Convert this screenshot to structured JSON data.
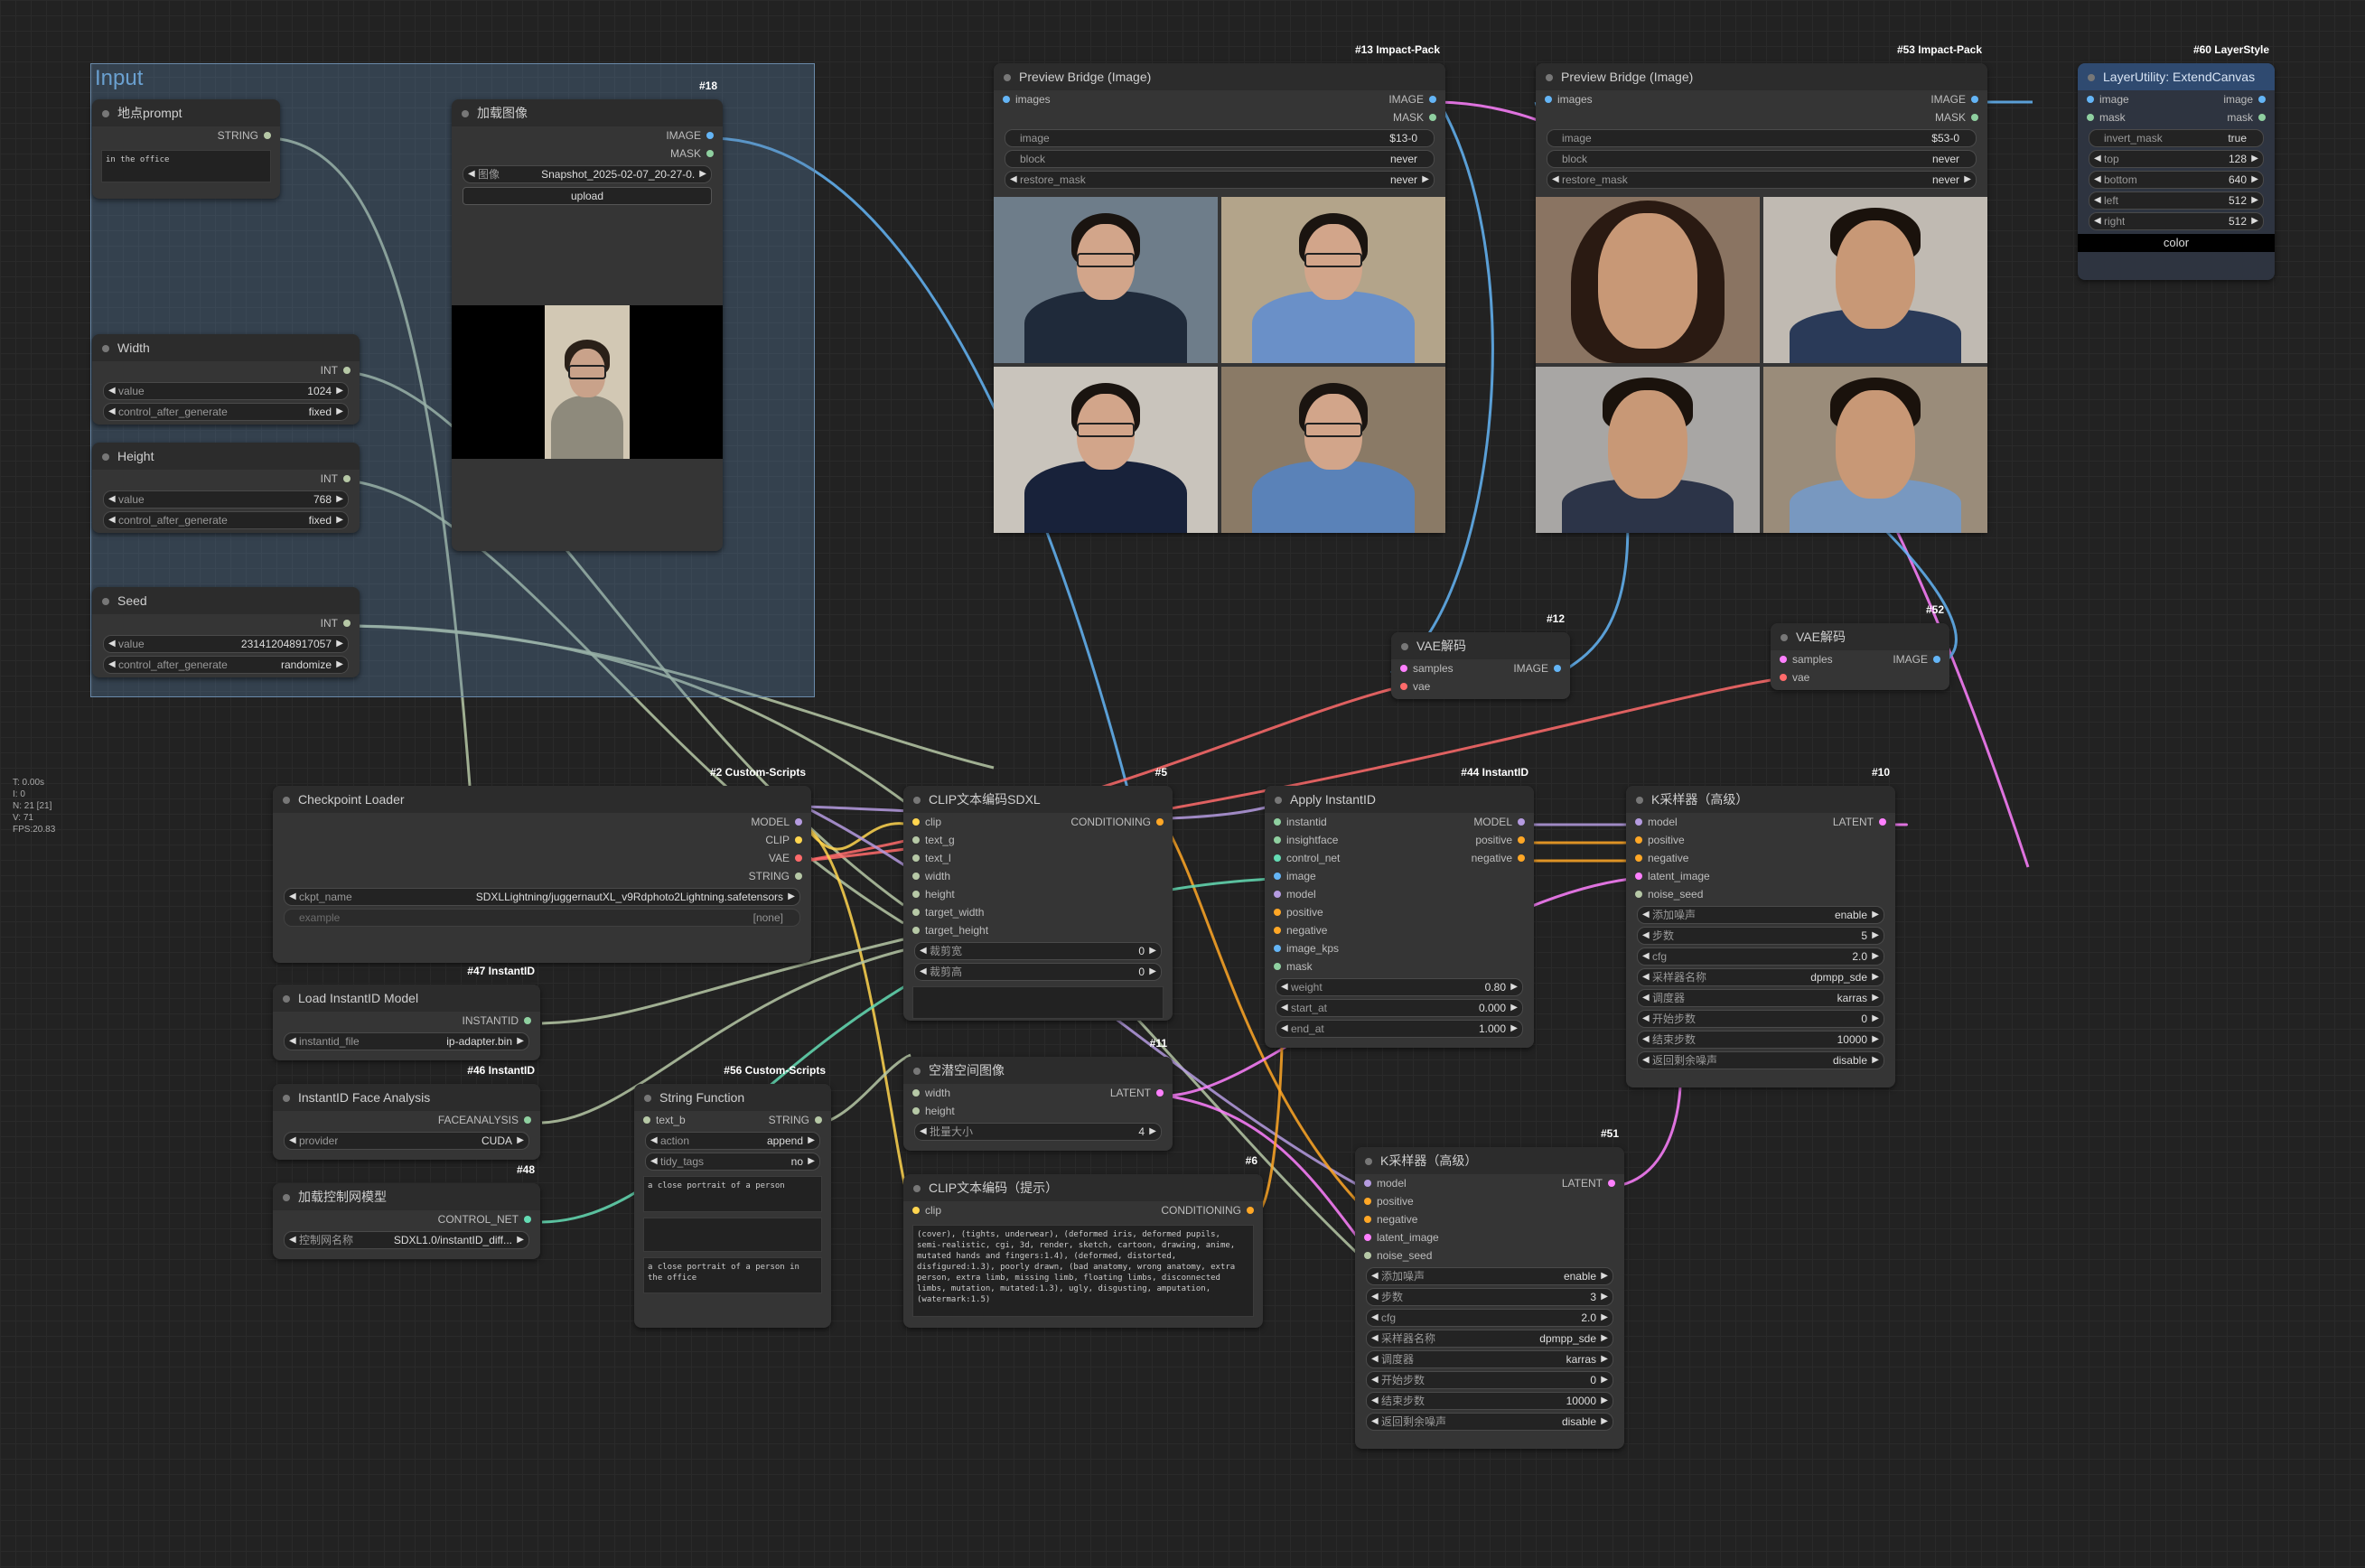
{
  "group": {
    "title": "Input"
  },
  "stats": [
    "T: 0.00s",
    "I: 0",
    "N: 21 [21]",
    "V: 71",
    "FPS:20.83"
  ],
  "nodes": {
    "prompt": {
      "title": "地点prompt",
      "out": "STRING",
      "text": "in the office"
    },
    "load_image": {
      "title": "加载图像",
      "id": "#18",
      "outs": [
        "IMAGE",
        "MASK"
      ],
      "image_label": "图像",
      "image_value": "Snapshot_2025-02-07_20-27-0...",
      "upload": "upload"
    },
    "width": {
      "title": "Width",
      "out": "INT",
      "w1l": "value",
      "w1v": "1024",
      "w2l": "control_after_generate",
      "w2v": "fixed"
    },
    "height": {
      "title": "Height",
      "out": "INT",
      "w1l": "value",
      "w1v": "768",
      "w2l": "control_after_generate",
      "w2v": "fixed"
    },
    "seed": {
      "title": "Seed",
      "out": "INT",
      "w1l": "value",
      "w1v": "231412048917057",
      "w2l": "control_after_generate",
      "w2v": "randomize"
    },
    "preview1": {
      "title": "Preview Bridge (Image)",
      "id": "#13 Impact-Pack",
      "in": "images",
      "outs": [
        "IMAGE",
        "MASK"
      ],
      "w1l": "image",
      "w1v": "$13-0",
      "w2l": "block",
      "w2v": "never",
      "w3l": "restore_mask",
      "w3v": "never"
    },
    "preview2": {
      "title": "Preview Bridge (Image)",
      "id": "#53 Impact-Pack",
      "in": "images",
      "outs": [
        "IMAGE",
        "MASK"
      ],
      "w1l": "image",
      "w1v": "$53-0",
      "w2l": "block",
      "w2v": "never",
      "w3l": "restore_mask",
      "w3v": "never"
    },
    "extend": {
      "title": "LayerUtility: ExtendCanvas",
      "id": "#60 LayerStyle",
      "ins": [
        "image",
        "mask"
      ],
      "outs": [
        "image",
        "mask"
      ],
      "w": [
        [
          "invert_mask",
          "true"
        ],
        [
          "top",
          "128"
        ],
        [
          "bottom",
          "640"
        ],
        [
          "left",
          "512"
        ],
        [
          "right",
          "512"
        ]
      ],
      "color_btn": "color"
    },
    "vae12": {
      "title": "VAE解码",
      "id": "#12",
      "ins": [
        "samples",
        "vae"
      ],
      "out": "IMAGE"
    },
    "vae52": {
      "title": "VAE解码",
      "id": "#52",
      "ins": [
        "samples",
        "vae"
      ],
      "out": "IMAGE"
    },
    "ckpt": {
      "title": "Checkpoint Loader",
      "id": "#2 Custom-Scripts",
      "outs": [
        "MODEL",
        "CLIP",
        "VAE",
        "STRING"
      ],
      "w1l": "ckpt_name",
      "w1v": "SDXLLightning/juggernautXL_v9Rdphoto2Lightning.safetensors",
      "w2l": "example",
      "w2v": "[none]"
    },
    "clip5": {
      "title": "CLIP文本编码SDXL",
      "id": "#5",
      "ins": [
        "clip",
        "text_g",
        "text_l",
        "width",
        "height",
        "target_width",
        "target_height"
      ],
      "out": "CONDITIONING",
      "w1l": "裁剪宽",
      "w1v": "0",
      "w2l": "裁剪高",
      "w2v": "0"
    },
    "apply": {
      "title": "Apply InstantID",
      "id": "#44 InstantID",
      "ins": [
        "instantid",
        "insightface",
        "control_net",
        "image",
        "model",
        "positive",
        "negative",
        "image_kps",
        "mask"
      ],
      "outs": [
        "MODEL",
        "positive",
        "negative"
      ],
      "w": [
        [
          "weight",
          "0.80"
        ],
        [
          "start_at",
          "0.000"
        ],
        [
          "end_at",
          "1.000"
        ]
      ]
    },
    "ks10": {
      "title": "K采样器（高级）",
      "id": "#10",
      "ins": [
        "model",
        "positive",
        "negative",
        "latent_image",
        "noise_seed"
      ],
      "out": "LATENT",
      "w": [
        [
          "添加噪声",
          "enable"
        ],
        [
          "步数",
          "5"
        ],
        [
          "cfg",
          "2.0"
        ],
        [
          "采样器名称",
          "dpmpp_sde"
        ],
        [
          "调度器",
          "karras"
        ],
        [
          "开始步数",
          "0"
        ],
        [
          "结束步数",
          "10000"
        ],
        [
          "返回剩余噪声",
          "disable"
        ]
      ]
    },
    "load_iid": {
      "title": "Load InstantID Model",
      "id": "#47 InstantID",
      "out": "INSTANTID",
      "w1l": "instantid_file",
      "w1v": "ip-adapter.bin"
    },
    "face": {
      "title": "InstantID Face Analysis",
      "id": "#46 InstantID",
      "out": "FACEANALYSIS",
      "w1l": "provider",
      "w1v": "CUDA"
    },
    "cnet": {
      "title": "加载控制网模型",
      "id": "#48",
      "out": "CONTROL_NET",
      "w1l": "控制网名称",
      "w1v": "SDXL1.0/instantID_diff..."
    },
    "strfn": {
      "title": "String Function",
      "id": "#56 Custom-Scripts",
      "in": "text_b",
      "out": "STRING",
      "w1l": "action",
      "w1v": "append",
      "w2l": "tidy_tags",
      "w2v": "no",
      "t1": "a close portrait of a person",
      "t2": "",
      "t3": "a close portrait of a person in the office"
    },
    "latent": {
      "title": "空潜空间图像",
      "id": "#11",
      "ins": [
        "width",
        "height"
      ],
      "out": "LATENT",
      "w1l": "批量大小",
      "w1v": "4"
    },
    "clip6": {
      "title": "CLIP文本编码（提示）",
      "id": "#6",
      "in": "clip",
      "out": "CONDITIONING",
      "text": "(cover), (tights, underwear), (deformed iris, deformed pupils, semi-realistic, cgi, 3d, render, sketch, cartoon, drawing, anime, mutated hands and fingers:1.4), (deformed, distorted, disfigured:1.3), poorly drawn, (bad anatomy, wrong anatomy, extra person, extra limb, missing limb, floating limbs, disconnected limbs, mutation, mutated:1.3), ugly, disgusting, amputation, (watermark:1.5)"
    },
    "ks51": {
      "title": "K采样器（高级）",
      "id": "#51",
      "ins": [
        "model",
        "positive",
        "negative",
        "latent_image",
        "noise_seed"
      ],
      "out": "LATENT",
      "w": [
        [
          "添加噪声",
          "enable"
        ],
        [
          "步数",
          "3"
        ],
        [
          "cfg",
          "2.0"
        ],
        [
          "采样器名称",
          "dpmpp_sde"
        ],
        [
          "调度器",
          "karras"
        ],
        [
          "开始步数",
          "0"
        ],
        [
          "结束步数",
          "10000"
        ],
        [
          "返回剩余噪声",
          "disable"
        ]
      ]
    }
  }
}
